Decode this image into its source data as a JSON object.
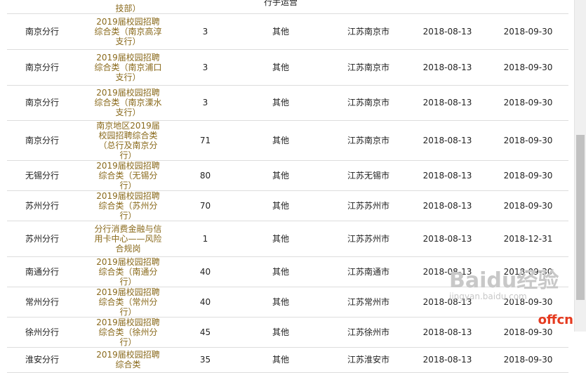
{
  "top_partial": {
    "job": "技部）",
    "category": "行手运营"
  },
  "rows": [
    {
      "branch": "南京分行",
      "job": "2019届校园招聘综合类（南京高淳支行）",
      "count": "3",
      "category": "其他",
      "location": "江苏南京市",
      "start": "2018-08-13",
      "end": "2018-09-30"
    },
    {
      "branch": "南京分行",
      "job": "2019届校园招聘综合类（南京浦口支行）",
      "count": "3",
      "category": "其他",
      "location": "江苏南京市",
      "start": "2018-08-13",
      "end": "2018-09-30"
    },
    {
      "branch": "南京分行",
      "job": "2019届校园招聘综合类（南京溧水支行）",
      "count": "3",
      "category": "其他",
      "location": "江苏南京市",
      "start": "2018-08-13",
      "end": "2018-09-30"
    },
    {
      "branch": "南京分行",
      "job": "南京地区2019届校园招聘综合类（总行及南京分行）",
      "count": "71",
      "category": "其他",
      "location": "江苏南京市",
      "start": "2018-08-13",
      "end": "2018-09-30"
    },
    {
      "branch": "无锡分行",
      "job": "2019届校园招聘综合类（无锡分行）",
      "count": "80",
      "category": "其他",
      "location": "江苏无锡市",
      "start": "2018-08-13",
      "end": "2018-09-30"
    },
    {
      "branch": "苏州分行",
      "job": "2019届校园招聘综合类（苏州分行）",
      "count": "70",
      "category": "其他",
      "location": "江苏苏州市",
      "start": "2018-08-13",
      "end": "2018-09-30"
    },
    {
      "branch": "苏州分行",
      "job": "分行消费金融与信用卡中心——风险合规岗",
      "count": "1",
      "category": "其他",
      "location": "江苏苏州市",
      "start": "2018-08-13",
      "end": "2018-12-31"
    },
    {
      "branch": "南通分行",
      "job": "2019届校园招聘综合类（南通分行）",
      "count": "40",
      "category": "其他",
      "location": "江苏南通市",
      "start": "2018-08-13",
      "end": "2018-09-30"
    },
    {
      "branch": "常州分行",
      "job": "2019届校园招聘综合类（常州分行）",
      "count": "40",
      "category": "其他",
      "location": "江苏常州市",
      "start": "2018-08-13",
      "end": "2018-09-30"
    },
    {
      "branch": "徐州分行",
      "job": "2019届校园招聘综合类（徐州分行）",
      "count": "45",
      "category": "其他",
      "location": "江苏徐州市",
      "start": "2018-08-13",
      "end": "2018-09-30"
    },
    {
      "branch": "淮安分行",
      "job": "2019届校园招聘综合类",
      "count": "35",
      "category": "其他",
      "location": "江苏淮安市",
      "start": "2018-08-13",
      "end": "2018-09-30"
    }
  ],
  "watermark": {
    "main": "Baidu经验",
    "sub": "jingyan.baidu.com"
  },
  "logo": "offcn"
}
